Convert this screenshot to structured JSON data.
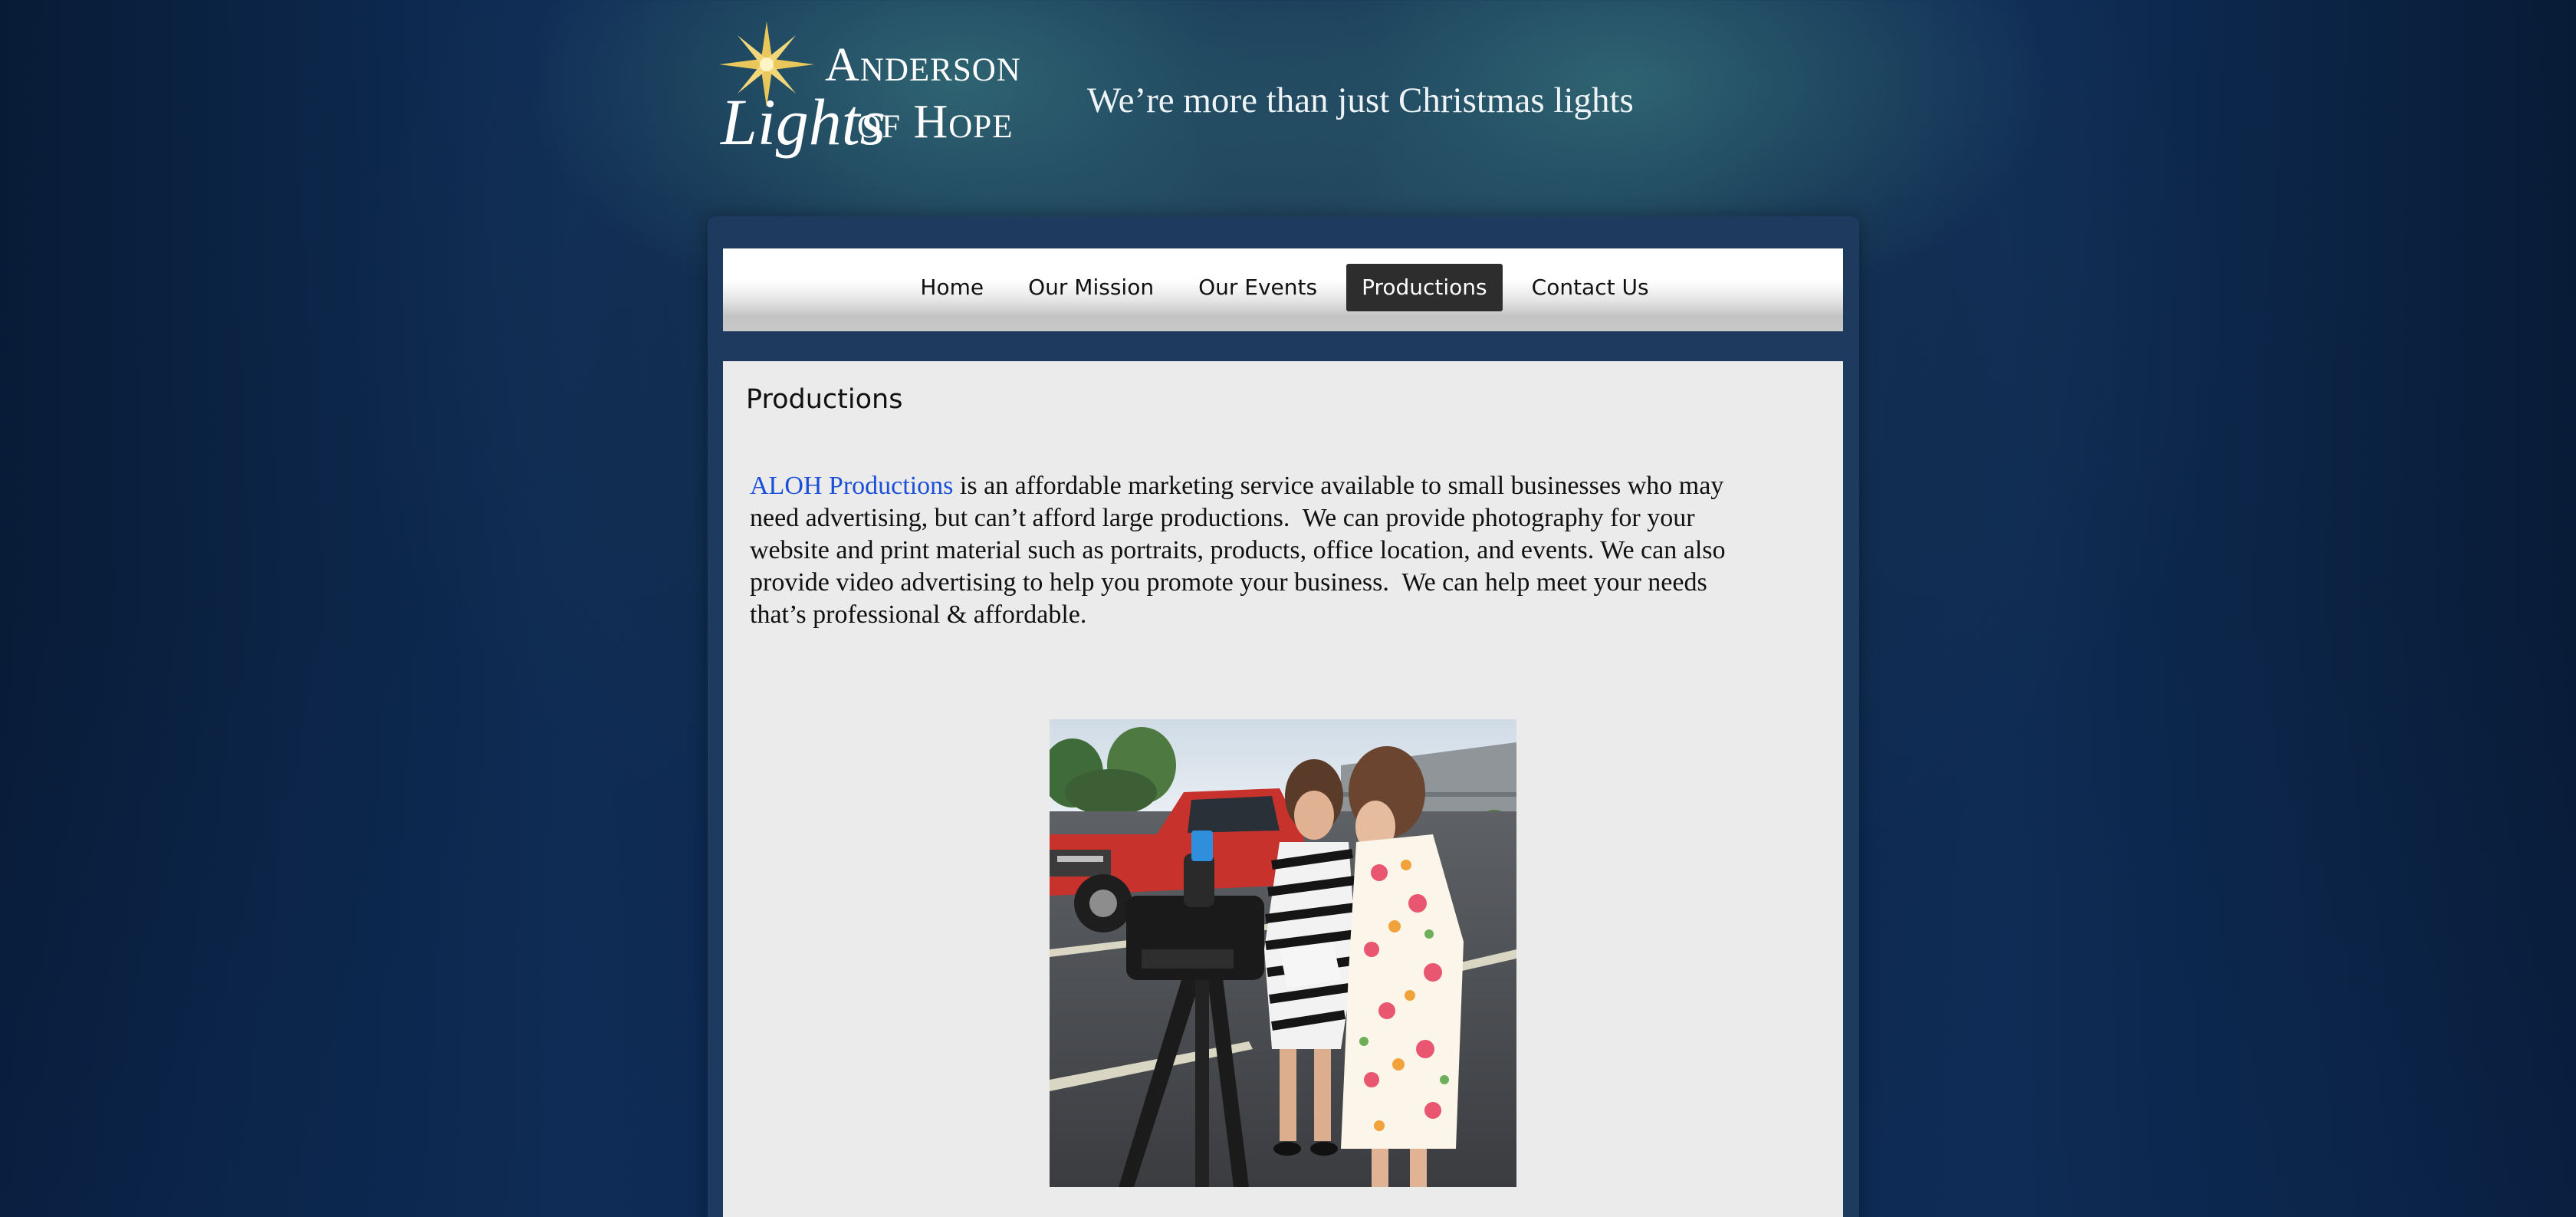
{
  "header": {
    "logo": {
      "word_top": "Anderson",
      "word_script": "Lights",
      "word_bottom": "of Hope",
      "star_color": "#e9c75a"
    },
    "tagline": "We’re more than just Christmas lights"
  },
  "nav": {
    "items": [
      {
        "label": "Home",
        "active": false
      },
      {
        "label": "Our Mission",
        "active": false
      },
      {
        "label": "Our Events",
        "active": false
      },
      {
        "label": "Productions",
        "active": true
      },
      {
        "label": "Contact Us",
        "active": false
      }
    ],
    "active_bg": "#2d2d2d"
  },
  "main": {
    "title": "Productions",
    "link_text": "ALOH Productions",
    "link_color": "#1a4fd8",
    "paragraph_lines": [
      " is an affordable marketing service available to small businesses who may",
      "need advertising, but can’t afford large productions.  We can provide photography for your",
      "website and print material such as portraits, products, office location, and events. We can also",
      "provide video advertising to help you promote your business.  We can help meet your needs",
      "that’s professional & affordable."
    ],
    "photo": {
      "icon": "photo-two-women-camera-tripod"
    }
  }
}
